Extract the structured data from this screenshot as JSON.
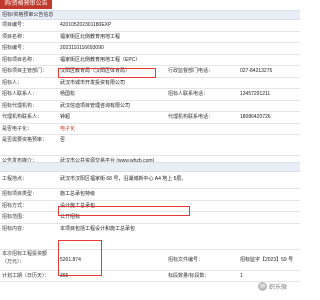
{
  "tab": {
    "label": "询/资格预审公告"
  },
  "band1": {
    "label": "招标/资格预审公告信息"
  },
  "rows": {
    "code": {
      "label": "项目编号：",
      "value": "420105202301180EXP"
    },
    "project": {
      "label": "项目名称：",
      "value": "福家街区北侧教育用地工程"
    },
    "bid_no": {
      "label": "招标编号：",
      "value": "2023110116693090"
    },
    "section": {
      "label": "招标项目名称：",
      "value": "福家街区北侧教育用地工程（EPC）"
    },
    "dept": {
      "label": "招标项目主管部门：",
      "value": "汉阳区教育局（汉阳区体育局）",
      "label2": "行政监督部门电话：",
      "value2": "027-84213275"
    },
    "owner": {
      "label": "招标人：",
      "value": "武汉市城市开发投资有限公司"
    },
    "contact1": {
      "label": "招标人联系人：",
      "value": "杨国松",
      "label2": "招标人联系电话：",
      "value2": "13457291211"
    },
    "agent": {
      "label": "招标代理机构：",
      "value": "武汉信迪项目管理咨询有限公司"
    },
    "contact2": {
      "label": "代理机构联系人：",
      "value": "钟超",
      "label2": "代理机构联系电话：",
      "value2": "18086420726"
    },
    "mode": {
      "label": "是否电子化：",
      "value": "电子化"
    },
    "prequal": {
      "label": "是否需要资格预审：",
      "value": "否"
    },
    "media": {
      "label": "公告发布媒介：",
      "value": "武汉市公共资源交易平台 (www.whzb.com)"
    },
    "location": {
      "label": "工程地点：",
      "value": "武汉市汉阳区福家街 68 号，沿湖城新中心 A4 地上 5层。"
    },
    "type": {
      "label": "招标项目类型：",
      "value": "施工总承包特级"
    },
    "method": {
      "label": "招标方式：",
      "value": "设计施工总承包"
    },
    "scope": {
      "label": "招标范围：",
      "value": "公开招标"
    },
    "content": {
      "label": "招标内容：",
      "value": "本项目包括工程设计和施工总承包"
    },
    "budget": {
      "label": "本次招标工程投资额（万元）：",
      "value": "5261.874",
      "label2": "招标文件编号：",
      "value2": "招标监字【2023】59 号"
    },
    "period": {
      "label": "计划工期（日历天）：",
      "value": "365",
      "label2": "标段数量/标段数：",
      "value2": "1"
    }
  },
  "watermark": {
    "text": "织乐微"
  }
}
